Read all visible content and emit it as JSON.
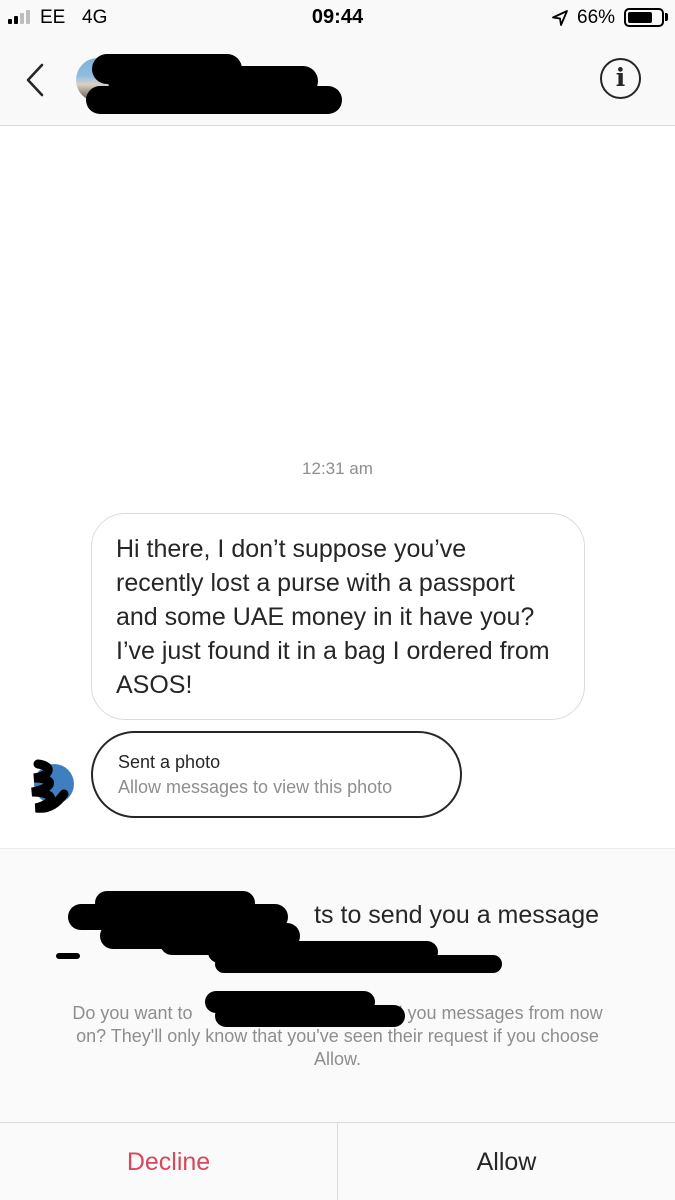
{
  "status_bar": {
    "carrier": "EE",
    "network": "4G",
    "time": "09:44",
    "battery_percent": "66%",
    "battery_level": 0.66,
    "icons": [
      "signal-icon",
      "location-arrow-icon",
      "battery-icon"
    ]
  },
  "header": {
    "back_icon": "chevron-left-icon",
    "info_icon": "info-icon",
    "info_glyph": "i"
  },
  "thread": {
    "timestamp": "12:31 am",
    "message": "Hi there, I don’t suppose you’ve recently lost a purse with a passport and some UAE money in it have you? I’ve just found it in a bag I ordered from ASOS!",
    "photo": {
      "title": "Sent a photo",
      "subtitle": "Allow messages to view this photo"
    }
  },
  "request": {
    "title_visible": "ts to send you a message",
    "body_part1": "Do you want to",
    "body_part2": "nd you messages from now on? They'll only know that you've seen their request if you choose Allow."
  },
  "actions": {
    "decline": "Decline",
    "allow": "Allow",
    "decline_color": "#d7485a"
  }
}
